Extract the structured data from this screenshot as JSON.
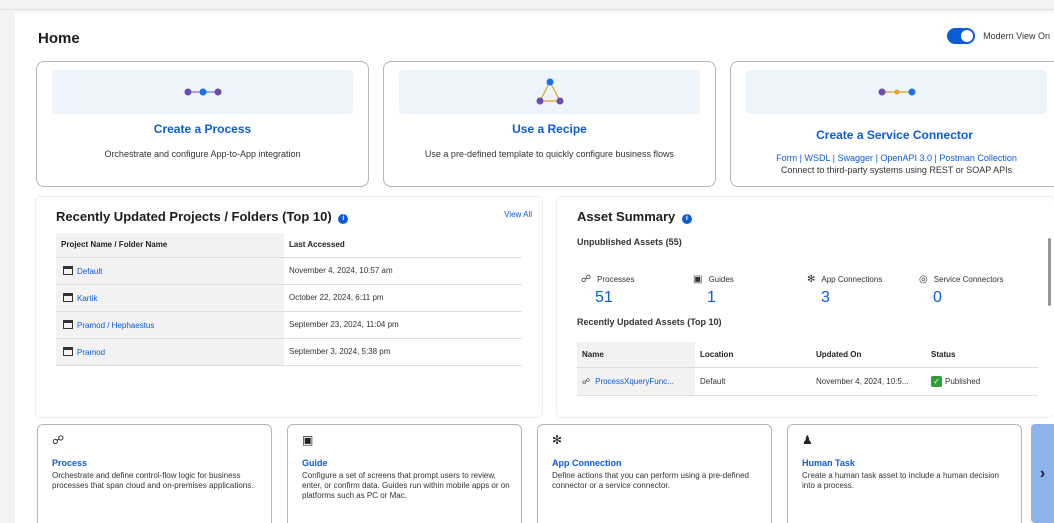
{
  "page": {
    "title": "Home"
  },
  "toggle": {
    "label": "Modern View On",
    "on": true,
    "accent": "#0b5cd5"
  },
  "cards": [
    {
      "title": "Create a Process",
      "desc": "Orchestrate and configure App-to-App integration",
      "icon": "three-dots-icon"
    },
    {
      "title": "Use a Recipe",
      "desc": "Use a pre-defined template to quickly configure business flows",
      "icon": "triangle-nodes-icon"
    },
    {
      "title": "Create a Service Connector",
      "links": [
        "Form",
        "WSDL",
        "Swagger",
        "OpenAPI 3.0",
        "Postman Collection"
      ],
      "desc": "Connect to third-party systems using REST or SOAP APIs",
      "icon": "connector-nodes-icon"
    }
  ],
  "projects": {
    "title": "Recently Updated Projects / Folders (Top 10)",
    "view_all": "View All",
    "columns": [
      "Project Name / Folder Name",
      "Last Accessed"
    ],
    "rows": [
      {
        "name": "Default",
        "accessed": "November 4, 2024, 10:57 am"
      },
      {
        "name": "Kartik",
        "accessed": "October 22, 2024, 6:11 pm"
      },
      {
        "name": "Pramod / Hephaestus",
        "accessed": "September 23, 2024, 11:04 pm"
      },
      {
        "name": "Pramod",
        "accessed": "September 3, 2024, 5:38 pm"
      }
    ]
  },
  "assets": {
    "title": "Asset Summary",
    "unpublished": "Unpublished Assets (55)",
    "stats": [
      {
        "label": "Processes",
        "value": "51",
        "icon": "process-icon"
      },
      {
        "label": "Guides",
        "value": "1",
        "icon": "guide-icon"
      },
      {
        "label": "App Connections",
        "value": "3",
        "icon": "app-connection-icon"
      },
      {
        "label": "Service Connectors",
        "value": "0",
        "icon": "service-connector-icon"
      }
    ],
    "recent_title": "Recently Updated Assets (Top 10)",
    "columns": [
      "Name",
      "Location",
      "Updated On",
      "Status"
    ],
    "rows": [
      {
        "name": "ProcessXqueryFunc...",
        "location": "Default",
        "updated": "November 4, 2024, 10:5...",
        "status": "Published"
      }
    ]
  },
  "asset_types": [
    {
      "title": "Process",
      "desc": "Orchestrate and define control-flow logic for business processes that span cloud and on-premises applications.",
      "icon": "process-icon"
    },
    {
      "title": "Guide",
      "desc": "Configure a set of screens that prompt users to review, enter, or confirm data. Guides run within mobile apps or on platforms such as PC or Mac.",
      "icon": "guide-icon"
    },
    {
      "title": "App Connection",
      "desc": "Define actions that you can perform using a pre-defined connector or a service connector.",
      "icon": "app-connection-icon"
    },
    {
      "title": "Human Task",
      "desc": "Create a human task asset to include a human decision into a process.",
      "icon": "human-task-icon"
    }
  ],
  "next_glyph": "›"
}
